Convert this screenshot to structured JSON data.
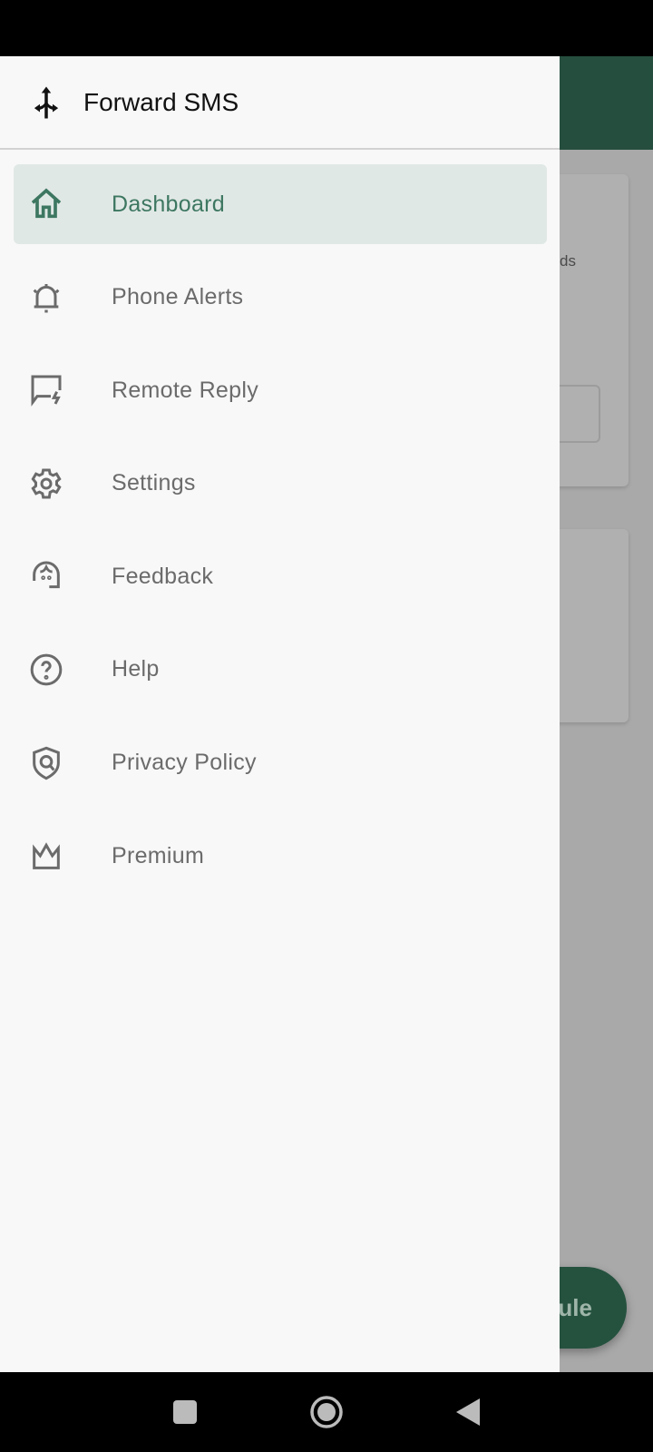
{
  "app": {
    "title": "Forward SMS",
    "logo_icon": "split-arrows-icon"
  },
  "colors": {
    "accent": "#3d7761",
    "app_bar": "#264e3e",
    "active_bg": "#e0e8e5"
  },
  "background": {
    "card_text": "ds",
    "fab_label": "ule"
  },
  "drawer": {
    "items": [
      {
        "label": "Dashboard",
        "icon": "home-icon",
        "active": true
      },
      {
        "label": "Phone Alerts",
        "icon": "bell-alert-icon"
      },
      {
        "label": "Remote Reply",
        "icon": "message-flash-icon"
      },
      {
        "label": "Settings",
        "icon": "gear-icon"
      },
      {
        "label": "Feedback",
        "icon": "headset-icon"
      },
      {
        "label": "Help",
        "icon": "help-circle-icon"
      },
      {
        "label": "Privacy Policy",
        "icon": "shield-icon"
      },
      {
        "label": "Premium",
        "icon": "crown-icon"
      }
    ]
  }
}
